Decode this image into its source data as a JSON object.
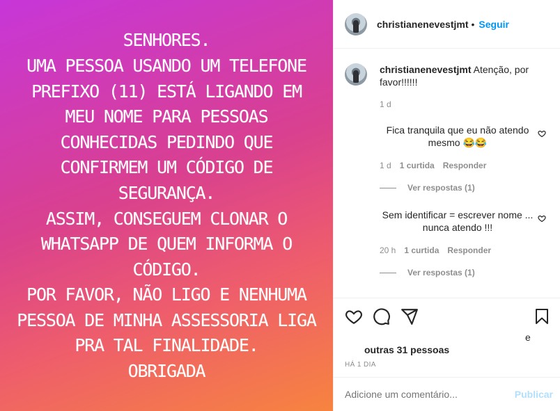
{
  "media": {
    "text": "SENHORES.\nUMA PESSOA USANDO UM TELEFONE PREFIXO (11) ESTÁ LIGANDO EM MEU NOME PARA PESSOAS CONHECIDAS PEDINDO QUE CONFIRMEM UM CÓDIGO DE SEGURANÇA.\nASSIM, CONSEGUEM CLONAR O WHATSAPP DE QUEM INFORMA O CÓDIGO.\nPOR FAVOR, NÃO LIGO E NENHUMA PESSOA DE MINHA ASSESSORIA LIGA PRA TAL FINALIDADE.\nOBRIGADA",
    "gradient_colors": [
      "#c736d9",
      "#d9408f",
      "#ee5d6c",
      "#f7843f"
    ]
  },
  "header": {
    "username": "christianenevestjmt",
    "separator": "•",
    "follow_label": "Seguir"
  },
  "caption": {
    "username": "christianenevestjmt",
    "text": "Atenção, por favor!!!!!!",
    "time": "1 d"
  },
  "comments": [
    {
      "text": "Fica tranquila que eu não atendo mesmo 😂😂",
      "time": "1 d",
      "likes": "1 curtida",
      "reply_label": "Responder",
      "view_replies": "Ver respostas (1)"
    },
    {
      "text": "Sem identificar = escrever nome ... nunca atendo !!!",
      "time": "20 h",
      "likes": "1 curtida",
      "reply_label": "Responder",
      "view_replies": "Ver respostas (1)"
    }
  ],
  "actions": {
    "icons": [
      "heart-icon",
      "comment-icon",
      "share-icon",
      "bookmark-icon"
    ]
  },
  "likes": {
    "conjunction": "e",
    "others": "outras 31 pessoas"
  },
  "time_ago": "HÁ 1 DIA",
  "add_comment": {
    "placeholder": "Adicione um comentário...",
    "publish_label": "Publicar"
  },
  "colors": {
    "accent": "#0095f6",
    "publish_disabled": "#b2dffc",
    "muted": "#8e8e8e",
    "text": "#262626"
  }
}
